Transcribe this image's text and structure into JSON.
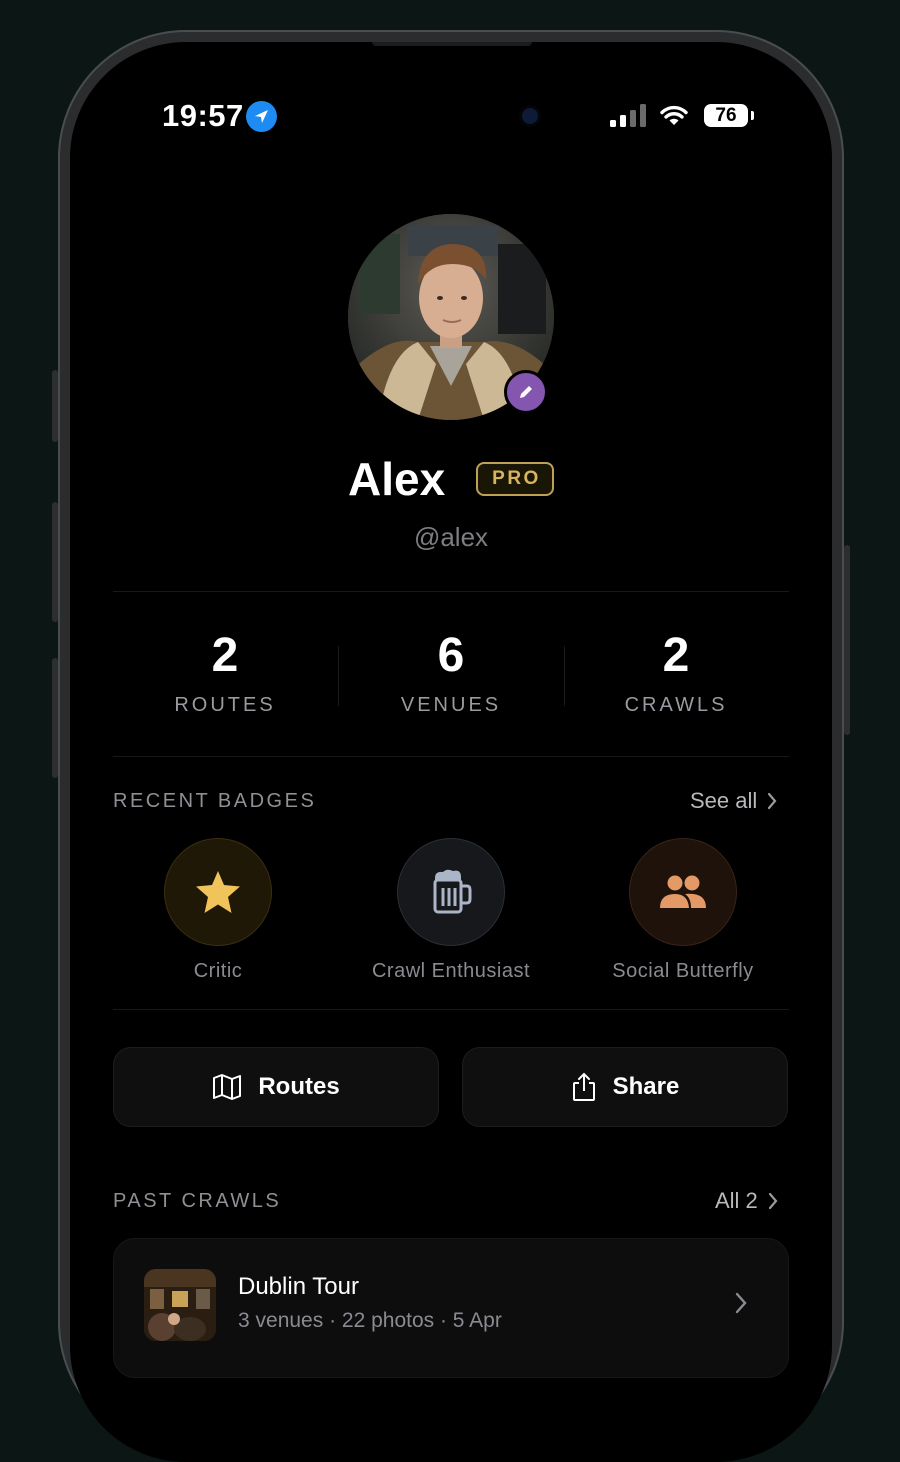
{
  "status_bar": {
    "time": "19:57",
    "battery": "76",
    "icons": [
      "location-arrow-icon",
      "cellular-signal-icon",
      "wifi-icon",
      "battery-icon"
    ]
  },
  "profile": {
    "name": "Alex",
    "badge": "PRO",
    "handle": "@alex",
    "accent_color": "#8456b0",
    "pro_color": "#d9b45e"
  },
  "stats": [
    {
      "value": "2",
      "label": "ROUTES"
    },
    {
      "value": "6",
      "label": "VENUES"
    },
    {
      "value": "2",
      "label": "CRAWLS"
    }
  ],
  "recent_badges": {
    "title": "RECENT BADGES",
    "link": "See all",
    "items": [
      {
        "label": "Critic",
        "icon": "star-icon",
        "color": "#f0c45a"
      },
      {
        "label": "Crawl Enthusiast",
        "icon": "beer-mug-icon",
        "color": "#aab6c8"
      },
      {
        "label": "Social Butterfly",
        "icon": "people-icon",
        "color": "#e39a66"
      }
    ]
  },
  "actions": {
    "routes_label": "Routes",
    "share_label": "Share"
  },
  "past_crawls": {
    "title": "PAST CRAWLS",
    "link": "All 2",
    "items": [
      {
        "title": "Dublin Tour",
        "meta": "3 venues · 22 photos · 5 Apr"
      }
    ]
  }
}
